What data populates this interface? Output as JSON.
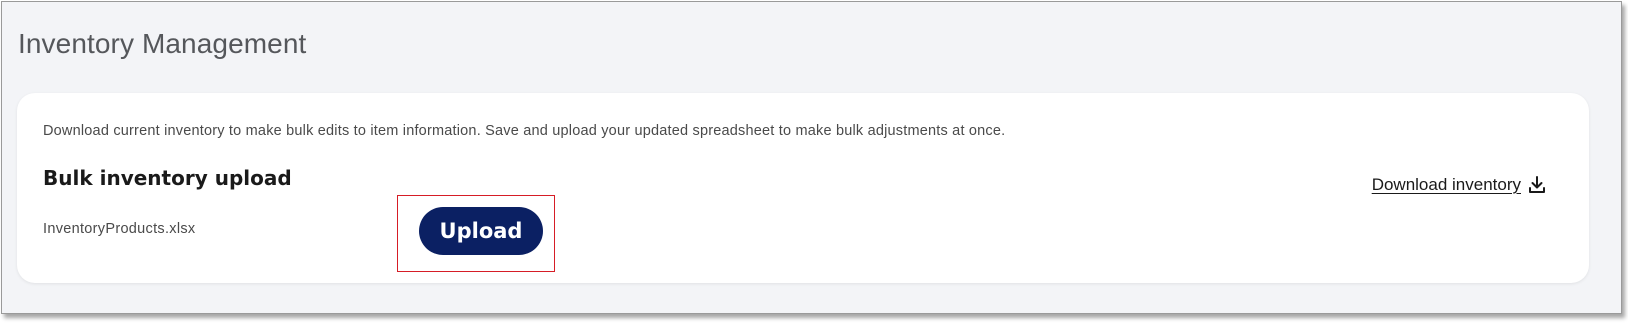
{
  "page": {
    "title": "Inventory Management"
  },
  "card": {
    "description": "Download current inventory to make bulk edits to item information. Save and upload your updated spreadsheet to make bulk adjustments at once.",
    "section_title": "Bulk inventory upload",
    "filename": "InventoryProducts.xlsx",
    "upload_label": "Upload",
    "download_label": "Download inventory",
    "download_icon": "download-icon"
  },
  "colors": {
    "page_background": "#f3f4f7",
    "card_background": "#ffffff",
    "primary_button": "#0b2063",
    "highlight_border": "#d61d26",
    "title_text": "#55575b"
  }
}
